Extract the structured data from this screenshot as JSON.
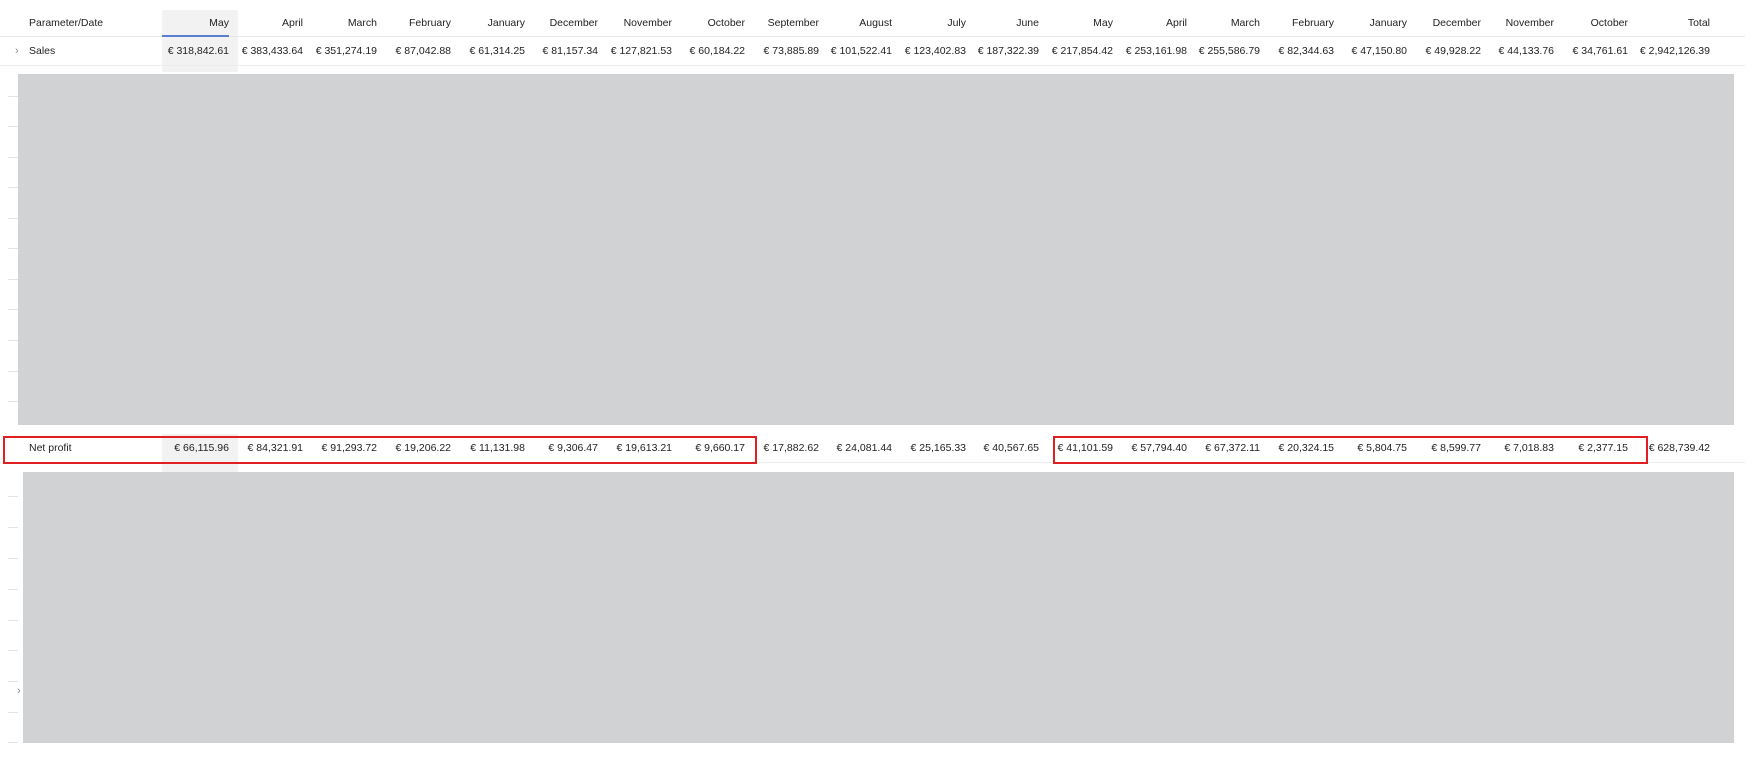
{
  "header": {
    "first": "Parameter/Date",
    "months": [
      "May",
      "April",
      "March",
      "February",
      "January",
      "December",
      "November",
      "October",
      "September",
      "August",
      "July",
      "June",
      "May",
      "April",
      "March",
      "February",
      "January",
      "December",
      "November",
      "October",
      "Total"
    ]
  },
  "rows": {
    "sales": {
      "label": "Sales",
      "values": [
        "€ 318,842.61",
        "€ 383,433.64",
        "€ 351,274.19",
        "€ 87,042.88",
        "€ 61,314.25",
        "€ 81,157.34",
        "€ 127,821.53",
        "€ 60,184.22",
        "€ 73,885.89",
        "€ 101,522.41",
        "€ 123,402.83",
        "€ 187,322.39",
        "€ 217,854.42",
        "€ 253,161.98",
        "€ 255,586.79",
        "€ 82,344.63",
        "€ 47,150.80",
        "€ 49,928.22",
        "€ 44,133.76",
        "€ 34,761.61",
        "€ 2,942,126.39"
      ]
    },
    "net_profit": {
      "label": "Net profit",
      "values": [
        "€ 66,115.96",
        "€ 84,321.91",
        "€ 91,293.72",
        "€ 19,206.22",
        "€ 11,131.98",
        "€ 9,306.47",
        "€ 19,613.21",
        "€ 9,660.17",
        "€ 17,882.62",
        "€ 24,081.44",
        "€ 25,165.33",
        "€ 40,567.65",
        "€ 41,101.59",
        "€ 57,794.40",
        "€ 67,372.11",
        "€ 20,324.15",
        "€ 5,804.75",
        "€ 8,599.77",
        "€ 7,018.83",
        "€ 2,377.15",
        "€ 628,739.42"
      ]
    }
  },
  "icons": {
    "expand": "chevron-right-icon"
  },
  "colors": {
    "mask": "#d1d2d4",
    "highlight": "#e02020",
    "selected_col": "#f2f2f2",
    "accent": "#5b7fd0"
  }
}
